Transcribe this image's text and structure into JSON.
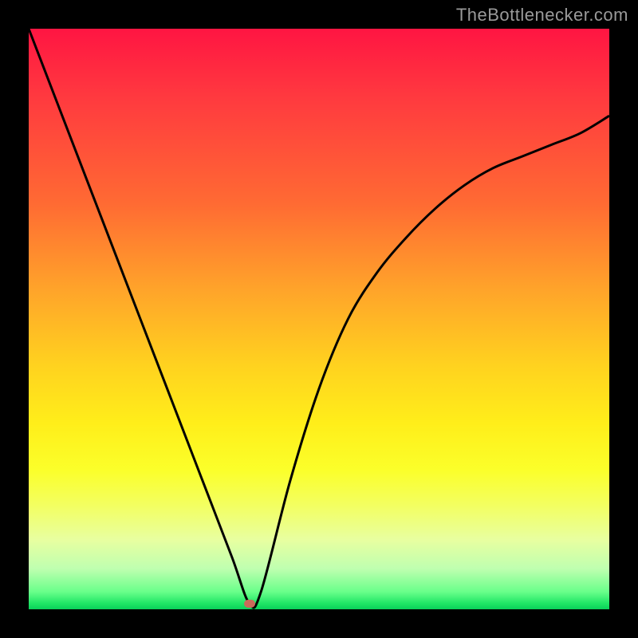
{
  "attribution": "TheBottlenecker.com",
  "colors": {
    "top": "#ff1542",
    "mid": "#ffd21f",
    "bottom": "#0ad05a",
    "curve": "#000000",
    "minpoint": "#cb6a5a",
    "frame": "#000000"
  },
  "chart_data": {
    "type": "line",
    "title": "",
    "xlabel": "",
    "ylabel": "",
    "xlim": [
      0,
      100
    ],
    "ylim": [
      0,
      100
    ],
    "grid": false,
    "series": [
      {
        "name": "bottleneck-curve",
        "x": [
          0,
          5,
          10,
          15,
          20,
          25,
          30,
          35,
          38,
          40,
          45,
          50,
          55,
          60,
          65,
          70,
          75,
          80,
          85,
          90,
          95,
          100
        ],
        "values": [
          100,
          87,
          74,
          61,
          48,
          35,
          22,
          9,
          1,
          3,
          22,
          38,
          50,
          58,
          64,
          69,
          73,
          76,
          78,
          80,
          82,
          85
        ]
      }
    ],
    "annotations": [
      {
        "name": "optimal-point",
        "x": 38,
        "y": 1
      }
    ]
  }
}
